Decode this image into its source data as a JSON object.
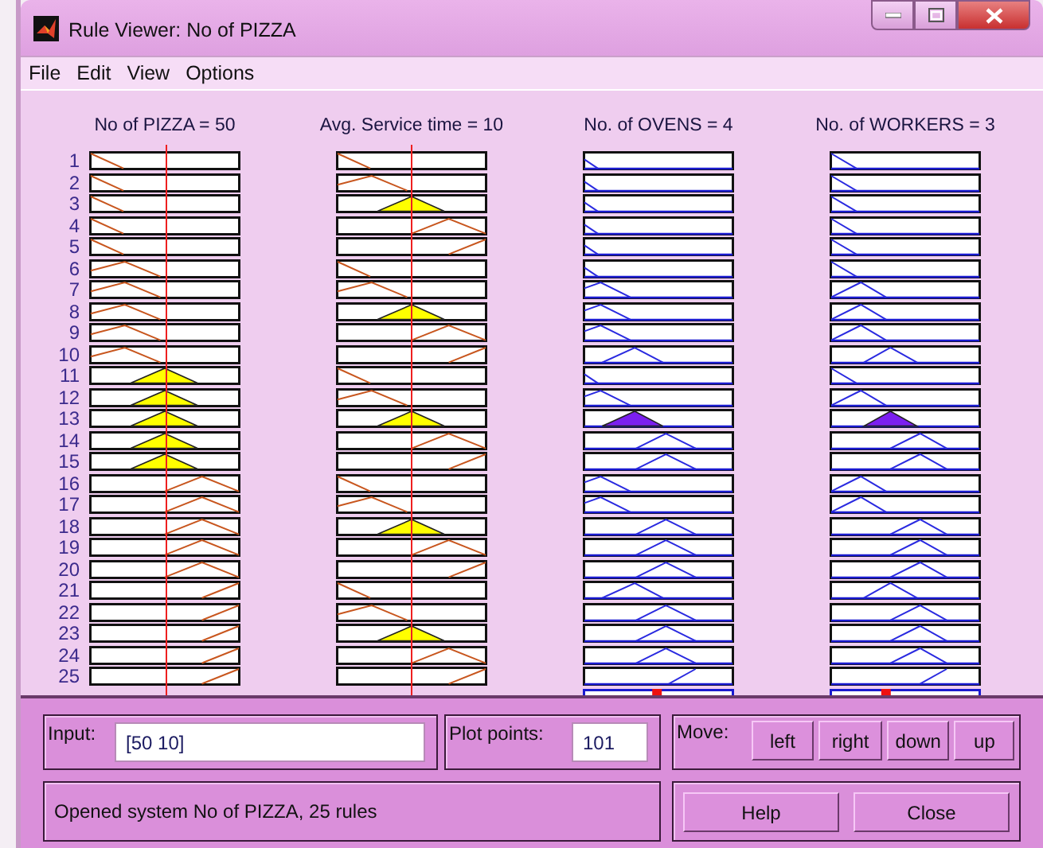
{
  "window": {
    "title": "Rule Viewer: No of PIZZA"
  },
  "menu": [
    "File",
    "Edit",
    "View",
    "Options"
  ],
  "variables": [
    {
      "label": "No of PIZZA = 50",
      "kind": "input"
    },
    {
      "label": "Avg. Service time = 10",
      "kind": "input"
    },
    {
      "label": "No. of OVENS = 4",
      "kind": "output"
    },
    {
      "label": "No. of WORKERS = 3",
      "kind": "output"
    }
  ],
  "rules": [
    {
      "number": "1",
      "cells": [
        {
          "kind": "left",
          "filled": false
        },
        {
          "kind": "left",
          "filled": false
        },
        {
          "kind": "left",
          "filled": false
        },
        {
          "kind": "left",
          "filled": false
        }
      ]
    },
    {
      "number": "2",
      "cells": [
        {
          "kind": "left",
          "filled": false
        },
        {
          "kind": "low",
          "filled": false
        },
        {
          "kind": "left",
          "filled": false
        },
        {
          "kind": "left",
          "filled": false
        }
      ]
    },
    {
      "number": "3",
      "cells": [
        {
          "kind": "left",
          "filled": false
        },
        {
          "kind": "mid",
          "filled": true
        },
        {
          "kind": "left",
          "filled": false
        },
        {
          "kind": "left",
          "filled": false
        }
      ]
    },
    {
      "number": "4",
      "cells": [
        {
          "kind": "left",
          "filled": false
        },
        {
          "kind": "high",
          "filled": false
        },
        {
          "kind": "left",
          "filled": false
        },
        {
          "kind": "left",
          "filled": false
        }
      ]
    },
    {
      "number": "5",
      "cells": [
        {
          "kind": "left",
          "filled": false
        },
        {
          "kind": "right",
          "filled": false
        },
        {
          "kind": "left",
          "filled": false
        },
        {
          "kind": "left",
          "filled": false
        }
      ]
    },
    {
      "number": "6",
      "cells": [
        {
          "kind": "low",
          "filled": false
        },
        {
          "kind": "left",
          "filled": false
        },
        {
          "kind": "left",
          "filled": false
        },
        {
          "kind": "left",
          "filled": false
        }
      ]
    },
    {
      "number": "7",
      "cells": [
        {
          "kind": "low",
          "filled": false
        },
        {
          "kind": "low",
          "filled": false
        },
        {
          "kind": "low",
          "filled": false
        },
        {
          "kind": "low",
          "filled": false
        }
      ]
    },
    {
      "number": "8",
      "cells": [
        {
          "kind": "low",
          "filled": false
        },
        {
          "kind": "mid",
          "filled": true
        },
        {
          "kind": "low",
          "filled": false
        },
        {
          "kind": "low",
          "filled": false
        }
      ]
    },
    {
      "number": "9",
      "cells": [
        {
          "kind": "low",
          "filled": false
        },
        {
          "kind": "high",
          "filled": false
        },
        {
          "kind": "low",
          "filled": false
        },
        {
          "kind": "low",
          "filled": false
        }
      ]
    },
    {
      "number": "10",
      "cells": [
        {
          "kind": "low",
          "filled": false
        },
        {
          "kind": "right",
          "filled": false
        },
        {
          "kind": "mid",
          "filled": false
        },
        {
          "kind": "mid",
          "filled": false
        }
      ]
    },
    {
      "number": "11",
      "cells": [
        {
          "kind": "mid",
          "filled": true
        },
        {
          "kind": "left",
          "filled": false
        },
        {
          "kind": "left",
          "filled": false
        },
        {
          "kind": "left",
          "filled": false
        }
      ]
    },
    {
      "number": "12",
      "cells": [
        {
          "kind": "mid",
          "filled": true
        },
        {
          "kind": "low",
          "filled": false
        },
        {
          "kind": "low",
          "filled": false
        },
        {
          "kind": "low",
          "filled": false
        }
      ]
    },
    {
      "number": "13",
      "cells": [
        {
          "kind": "mid",
          "filled": true
        },
        {
          "kind": "mid",
          "filled": true
        },
        {
          "kind": "mid",
          "filled": true
        },
        {
          "kind": "mid",
          "filled": true
        }
      ]
    },
    {
      "number": "14",
      "cells": [
        {
          "kind": "mid",
          "filled": true
        },
        {
          "kind": "high",
          "filled": false
        },
        {
          "kind": "high",
          "filled": false
        },
        {
          "kind": "high",
          "filled": false
        }
      ]
    },
    {
      "number": "15",
      "cells": [
        {
          "kind": "mid",
          "filled": true
        },
        {
          "kind": "right",
          "filled": false
        },
        {
          "kind": "high",
          "filled": false
        },
        {
          "kind": "high",
          "filled": false
        }
      ]
    },
    {
      "number": "16",
      "cells": [
        {
          "kind": "high",
          "filled": false
        },
        {
          "kind": "left",
          "filled": false
        },
        {
          "kind": "low",
          "filled": false
        },
        {
          "kind": "low",
          "filled": false
        }
      ]
    },
    {
      "number": "17",
      "cells": [
        {
          "kind": "high",
          "filled": false
        },
        {
          "kind": "low",
          "filled": false
        },
        {
          "kind": "low",
          "filled": false
        },
        {
          "kind": "low",
          "filled": false
        }
      ]
    },
    {
      "number": "18",
      "cells": [
        {
          "kind": "high",
          "filled": false
        },
        {
          "kind": "mid",
          "filled": true
        },
        {
          "kind": "high",
          "filled": false
        },
        {
          "kind": "high",
          "filled": false
        }
      ]
    },
    {
      "number": "19",
      "cells": [
        {
          "kind": "high",
          "filled": false
        },
        {
          "kind": "high",
          "filled": false
        },
        {
          "kind": "high",
          "filled": false
        },
        {
          "kind": "high",
          "filled": false
        }
      ]
    },
    {
      "number": "20",
      "cells": [
        {
          "kind": "high",
          "filled": false
        },
        {
          "kind": "right",
          "filled": false
        },
        {
          "kind": "high",
          "filled": false
        },
        {
          "kind": "high",
          "filled": false
        }
      ]
    },
    {
      "number": "21",
      "cells": [
        {
          "kind": "right",
          "filled": false
        },
        {
          "kind": "left",
          "filled": false
        },
        {
          "kind": "mid",
          "filled": false
        },
        {
          "kind": "mid",
          "filled": false
        }
      ]
    },
    {
      "number": "22",
      "cells": [
        {
          "kind": "right",
          "filled": false
        },
        {
          "kind": "low",
          "filled": false
        },
        {
          "kind": "high",
          "filled": false
        },
        {
          "kind": "high",
          "filled": false
        }
      ]
    },
    {
      "number": "23",
      "cells": [
        {
          "kind": "right",
          "filled": false
        },
        {
          "kind": "mid",
          "filled": true
        },
        {
          "kind": "high",
          "filled": false
        },
        {
          "kind": "high",
          "filled": false
        }
      ]
    },
    {
      "number": "24",
      "cells": [
        {
          "kind": "right",
          "filled": false
        },
        {
          "kind": "high",
          "filled": false
        },
        {
          "kind": "high",
          "filled": false
        },
        {
          "kind": "high",
          "filled": false
        }
      ]
    },
    {
      "number": "25",
      "cells": [
        {
          "kind": "right",
          "filled": false
        },
        {
          "kind": "right",
          "filled": false
        },
        {
          "kind": "right",
          "filled": false
        },
        {
          "kind": "right",
          "filled": false
        }
      ]
    }
  ],
  "input": {
    "label": "Input:",
    "value": "[50 10]"
  },
  "plot_points": {
    "label": "Plot points:",
    "value": "101"
  },
  "move": {
    "label": "Move:",
    "buttons": [
      "left",
      "right",
      "down",
      "up"
    ]
  },
  "status": "Opened system No of PIZZA, 25 rules",
  "buttons": [
    "Help",
    "Close"
  ]
}
